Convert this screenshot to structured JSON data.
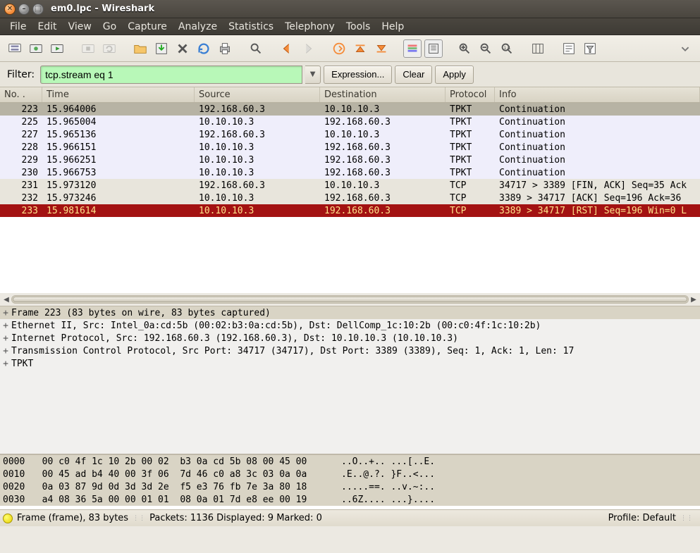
{
  "window": {
    "title": "em0.lpc - Wireshark"
  },
  "menu": [
    "File",
    "Edit",
    "View",
    "Go",
    "Capture",
    "Analyze",
    "Statistics",
    "Telephony",
    "Tools",
    "Help"
  ],
  "filterbar": {
    "label": "Filter:",
    "value": "tcp.stream eq 1",
    "expression": "Expression...",
    "clear": "Clear",
    "apply": "Apply"
  },
  "columns": {
    "no": "No. .",
    "time": "Time",
    "src": "Source",
    "dst": "Destination",
    "proto": "Protocol",
    "info": "Info"
  },
  "packets": [
    {
      "no": "223",
      "time": "15.964006",
      "src": "192.168.60.3",
      "dst": "10.10.10.3",
      "proto": "TPKT",
      "info": "Continuation",
      "style": "sel"
    },
    {
      "no": "225",
      "time": "15.965004",
      "src": "10.10.10.3",
      "dst": "192.168.60.3",
      "proto": "TPKT",
      "info": "Continuation",
      "style": "light"
    },
    {
      "no": "227",
      "time": "15.965136",
      "src": "192.168.60.3",
      "dst": "10.10.10.3",
      "proto": "TPKT",
      "info": "Continuation",
      "style": "light"
    },
    {
      "no": "228",
      "time": "15.966151",
      "src": "10.10.10.3",
      "dst": "192.168.60.3",
      "proto": "TPKT",
      "info": "Continuation",
      "style": "light"
    },
    {
      "no": "229",
      "time": "15.966251",
      "src": "10.10.10.3",
      "dst": "192.168.60.3",
      "proto": "TPKT",
      "info": "Continuation",
      "style": "light"
    },
    {
      "no": "230",
      "time": "15.966753",
      "src": "10.10.10.3",
      "dst": "192.168.60.3",
      "proto": "TPKT",
      "info": "Continuation",
      "style": "light"
    },
    {
      "no": "231",
      "time": "15.973120",
      "src": "192.168.60.3",
      "dst": "10.10.10.3",
      "proto": "TCP",
      "info": "34717 > 3389 [FIN, ACK] Seq=35 Ack",
      "style": "tcp"
    },
    {
      "no": "232",
      "time": "15.973246",
      "src": "10.10.10.3",
      "dst": "192.168.60.3",
      "proto": "TCP",
      "info": "3389 > 34717 [ACK] Seq=196 Ack=36 ",
      "style": "tcp"
    },
    {
      "no": "233",
      "time": "15.981614",
      "src": "10.10.10.3",
      "dst": "192.168.60.3",
      "proto": "TCP",
      "info": "3389 > 34717 [RST] Seq=196 Win=0 L",
      "style": "rst"
    }
  ],
  "details": [
    {
      "text": "Frame 223 (83 bytes on wire, 83 bytes captured)",
      "sel": true
    },
    {
      "text": "Ethernet II, Src: Intel_0a:cd:5b (00:02:b3:0a:cd:5b), Dst: DellComp_1c:10:2b (00:c0:4f:1c:10:2b)",
      "sel": false
    },
    {
      "text": "Internet Protocol, Src: 192.168.60.3 (192.168.60.3), Dst: 10.10.10.3 (10.10.10.3)",
      "sel": false
    },
    {
      "text": "Transmission Control Protocol, Src Port: 34717 (34717), Dst Port: 3389 (3389), Seq: 1, Ack: 1, Len: 17",
      "sel": false
    },
    {
      "text": "TPKT",
      "sel": false
    }
  ],
  "hex": [
    {
      "off": "0000",
      "bytes": "00 c0 4f 1c 10 2b 00 02  b3 0a cd 5b 08 00 45 00",
      "ascii": "..O..+.. ...[..E.",
      "sel": true
    },
    {
      "off": "0010",
      "bytes": "00 45 ad b4 40 00 3f 06  7d 46 c0 a8 3c 03 0a 0a",
      "ascii": ".E..@.?. }F..<...",
      "sel": true
    },
    {
      "off": "0020",
      "bytes": "0a 03 87 9d 0d 3d 3d 2e  f5 e3 76 fb 7e 3a 80 18",
      "ascii": ".....==. ..v.~:..",
      "sel": true
    },
    {
      "off": "0030",
      "bytes": "a4 08 36 5a 00 00 01 01  08 0a 01 7d e8 ee 00 19",
      "ascii": "..6Z.... ...}....",
      "sel": true
    }
  ],
  "status": {
    "frame": "Frame (frame), 83 bytes",
    "packets": "Packets: 1136 Displayed: 9 Marked: 0",
    "profile": "Profile: Default"
  }
}
